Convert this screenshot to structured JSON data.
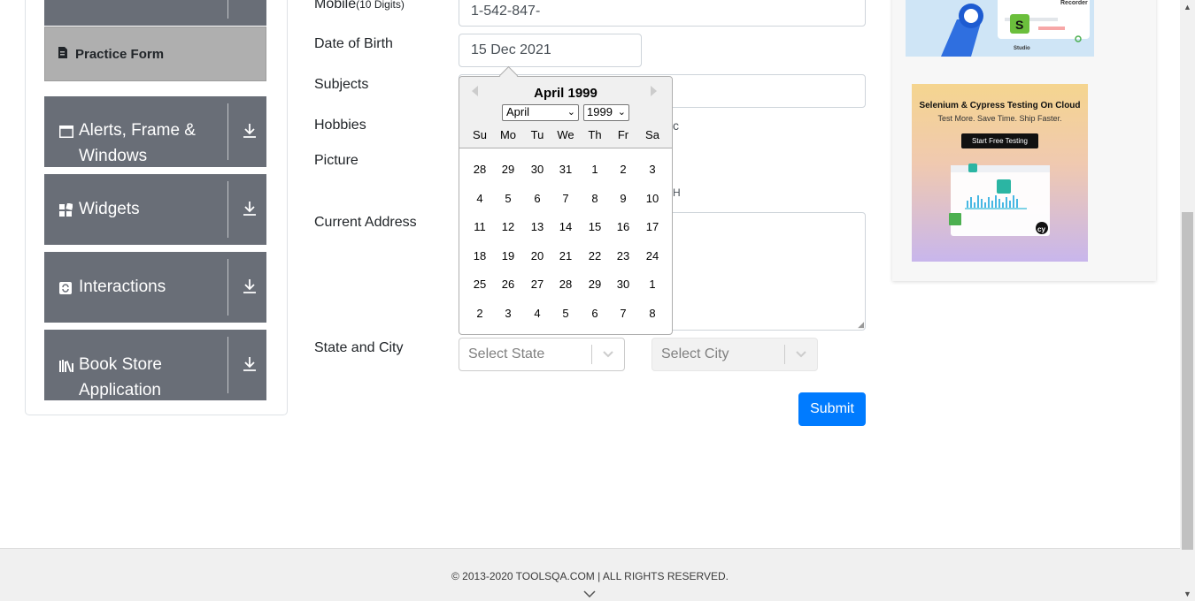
{
  "sidebar": {
    "practice_form": {
      "label": "Practice Form",
      "icon": "file-icon"
    },
    "groups": [
      {
        "label": "Alerts, Frame & Windows",
        "icon": "window-icon"
      },
      {
        "label": "Widgets",
        "icon": "widgets-icon"
      },
      {
        "label": "Interactions",
        "icon": "interactions-icon"
      },
      {
        "label": "Book Store Application",
        "icon": "book-icon"
      }
    ]
  },
  "form": {
    "mobile": {
      "label": "Mobile",
      "hint": "(10 Digits)",
      "value": "1-542-847-"
    },
    "dob": {
      "label": "Date of Birth",
      "value": "15 Dec 2021"
    },
    "subjects": {
      "label": "Subjects"
    },
    "hobbies": {
      "label": "Hobbies",
      "partial_text": "c"
    },
    "picture": {
      "label": "Picture",
      "partial_text": "H"
    },
    "address": {
      "label": "Current Address"
    },
    "state_city": {
      "label": "State and City",
      "state_placeholder": "Select State",
      "city_placeholder": "Select City"
    },
    "submit": "Submit"
  },
  "datepicker": {
    "title": "April 1999",
    "month": "April",
    "year": "1999",
    "day_names": [
      "Su",
      "Mo",
      "Tu",
      "We",
      "Th",
      "Fr",
      "Sa"
    ],
    "weeks": [
      [
        "28",
        "29",
        "30",
        "31",
        "1",
        "2",
        "3"
      ],
      [
        "4",
        "5",
        "6",
        "7",
        "8",
        "9",
        "10"
      ],
      [
        "11",
        "12",
        "13",
        "14",
        "15",
        "16",
        "17"
      ],
      [
        "18",
        "19",
        "20",
        "21",
        "22",
        "23",
        "24"
      ],
      [
        "25",
        "26",
        "27",
        "28",
        "29",
        "30",
        "1"
      ],
      [
        "2",
        "3",
        "4",
        "5",
        "6",
        "7",
        "8"
      ]
    ]
  },
  "ads": {
    "top": {
      "labels": [
        "Recorder",
        "Studio"
      ]
    },
    "bottom": {
      "title": "Selenium & Cypress Testing On Cloud",
      "subtitle": "Test More. Save Time. Ship Faster.",
      "button": "Start Free Testing"
    }
  },
  "footer": {
    "text": "© 2013-2020 TOOLSQA.COM | ALL RIGHTS RESERVED."
  },
  "colors": {
    "sidebar_group": "#696e77",
    "active_item": "#afafaf",
    "primary": "#007bff"
  }
}
